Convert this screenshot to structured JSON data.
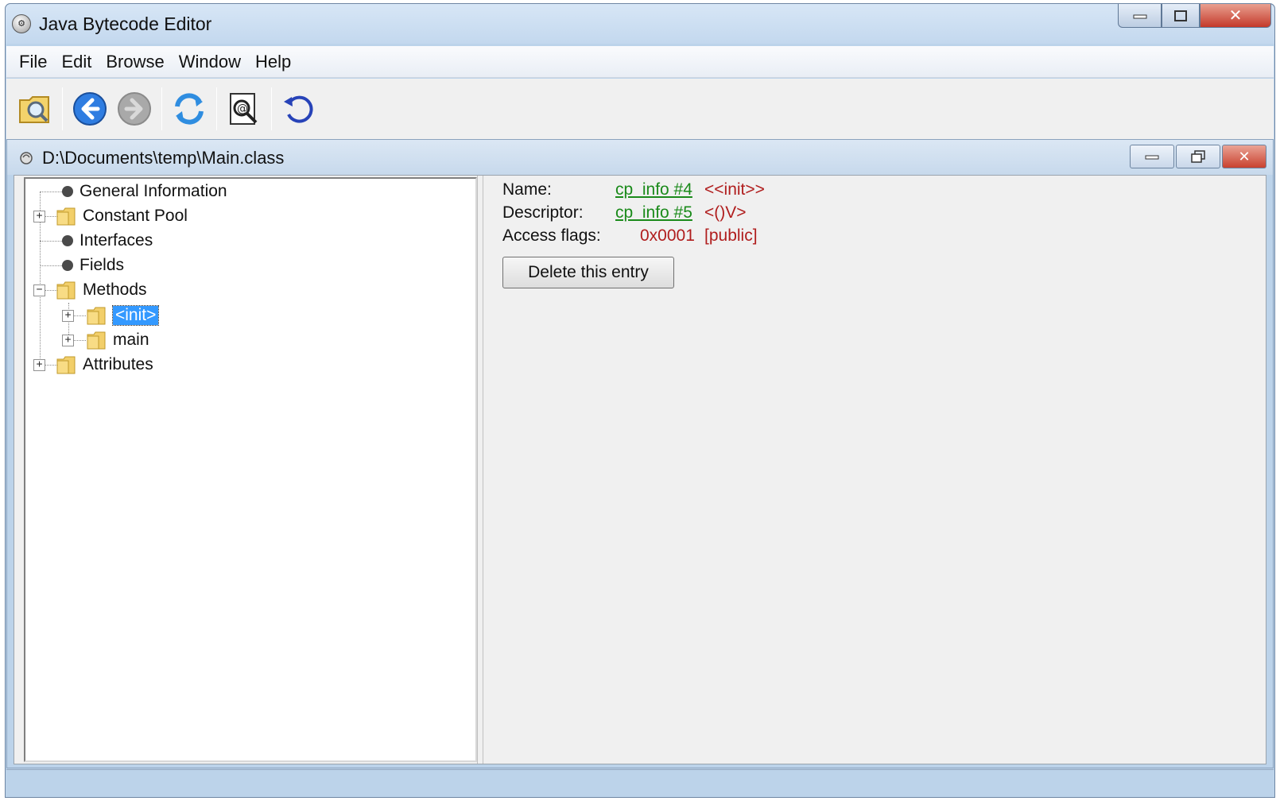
{
  "window": {
    "title": "Java Bytecode Editor"
  },
  "menu": [
    "File",
    "Edit",
    "Browse",
    "Window",
    "Help"
  ],
  "toolbar": {
    "buttons": [
      {
        "name": "open-class-icon",
        "enabled": true
      },
      {
        "name": "back-icon",
        "enabled": true
      },
      {
        "name": "forward-icon",
        "enabled": false
      },
      {
        "name": "reload-icon",
        "enabled": true
      },
      {
        "name": "search-icon",
        "enabled": true
      },
      {
        "name": "refresh-icon",
        "enabled": true
      }
    ]
  },
  "frame": {
    "title": "D:\\Documents\\temp\\Main.class"
  },
  "tree": {
    "nodes": [
      {
        "label": "General Information",
        "type": "leaf"
      },
      {
        "label": "Constant Pool",
        "type": "folder",
        "expanded": false
      },
      {
        "label": "Interfaces",
        "type": "leaf"
      },
      {
        "label": "Fields",
        "type": "leaf"
      },
      {
        "label": "Methods",
        "type": "folder",
        "expanded": true
      },
      {
        "label": "<init>",
        "type": "folder",
        "expanded": false,
        "selected": true
      },
      {
        "label": "main",
        "type": "folder",
        "expanded": false
      },
      {
        "label": "Attributes",
        "type": "folder",
        "expanded": false
      }
    ]
  },
  "details": {
    "name_label": "Name:",
    "name_link": "cp_info #4",
    "name_value": "<<init>>",
    "descriptor_label": "Descriptor:",
    "descriptor_link": "cp_info #5",
    "descriptor_value": "<()V>",
    "access_label": "Access flags:",
    "access_value": "0x0001",
    "access_desc": "[public]",
    "delete_button": "Delete this entry"
  },
  "colors": {
    "link": "#1a8a1a",
    "value": "#b01d1d",
    "selection": "#3399ff"
  }
}
